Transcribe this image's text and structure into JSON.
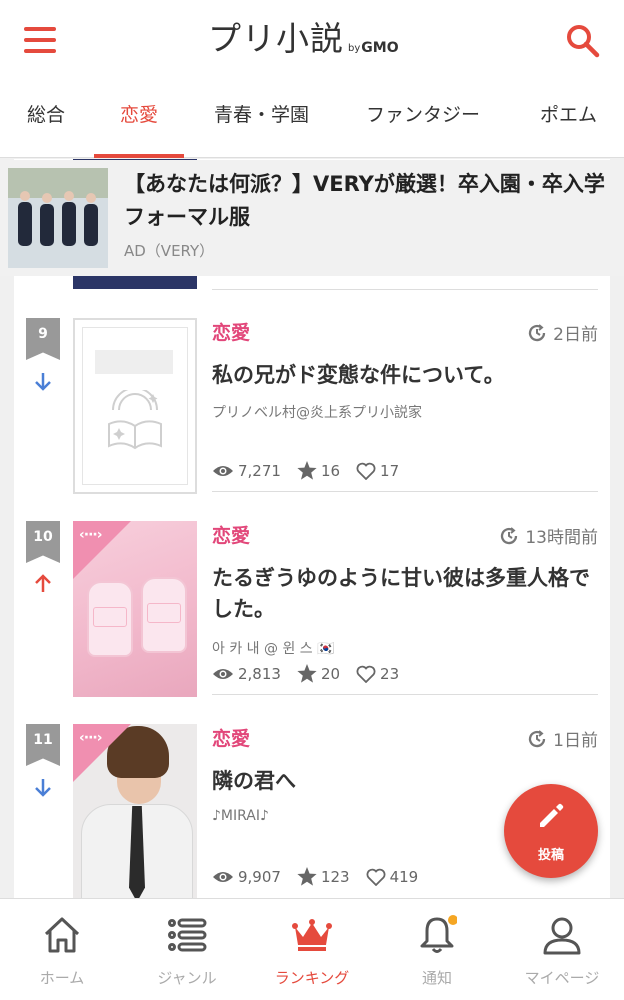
{
  "header": {
    "logo": "プリ小説",
    "logo_by": "by",
    "logo_brand": "GMO"
  },
  "tabs": [
    {
      "label": "総合",
      "active": false
    },
    {
      "label": "恋愛",
      "active": true
    },
    {
      "label": "青春・学園",
      "active": false
    },
    {
      "label": "ファンタジー",
      "active": false
    },
    {
      "label": "ポエム",
      "active": false
    }
  ],
  "ad": {
    "title": "【あなたは何派？】VERYが厳選！卒入園・卒入学フォーマル服",
    "source": "AD（VERY）"
  },
  "ranking": [
    {
      "rank": "9",
      "trend": "down",
      "genre": "恋愛",
      "time": "2日前",
      "title": "私の兄がド変態な件について。",
      "author": "プリノベル村@炎上系プリ小説家",
      "views": "7,271",
      "stars": "16",
      "likes": "17"
    },
    {
      "rank": "10",
      "trend": "up",
      "genre": "恋愛",
      "time": "13時間前",
      "title": "たるぎうゆのように甘い彼は多重人格でした。",
      "author": "아 카 내 @ 윈 스 🇰🇷",
      "views": "2,813",
      "stars": "20",
      "likes": "23"
    },
    {
      "rank": "11",
      "trend": "down",
      "genre": "恋愛",
      "time": "1日前",
      "title": "隣の君へ",
      "author": "♪MIRAI♪",
      "views": "9,907",
      "stars": "123",
      "likes": "419"
    }
  ],
  "fab": {
    "label": "投稿"
  },
  "bottom_nav": [
    {
      "label": "ホーム",
      "icon": "home-icon",
      "active": false
    },
    {
      "label": "ジャンル",
      "icon": "list-icon",
      "active": false
    },
    {
      "label": "ランキング",
      "icon": "crown-icon",
      "active": true
    },
    {
      "label": "通知",
      "icon": "bell-icon",
      "active": false
    },
    {
      "label": "マイページ",
      "icon": "user-icon",
      "active": false
    }
  ],
  "colors": {
    "accent": "#e54a3d",
    "genre": "#e2477a",
    "trend_up": "#e54a3d",
    "trend_down": "#4a7fd6",
    "notification_dot": "#f5a623"
  }
}
